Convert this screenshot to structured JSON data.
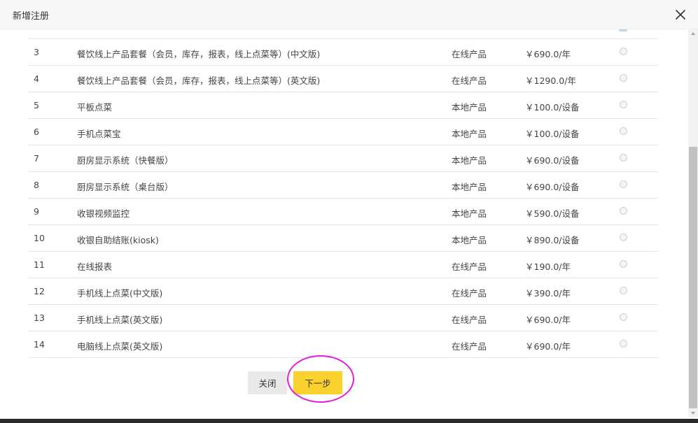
{
  "dialog": {
    "title": "新增注册",
    "close_icon": "close-icon"
  },
  "products": [
    {
      "num": "3",
      "name": "餐饮线上产品套餐（会员，库存，报表，线上点菜等）(中文版)",
      "type": "在线产品",
      "price": "￥690.0/年"
    },
    {
      "num": "4",
      "name": "餐饮线上产品套餐（会员，库存，报表，线上点菜等）(英文版)",
      "type": "在线产品",
      "price": "￥1290.0/年"
    },
    {
      "num": "5",
      "name": "平板点菜",
      "type": "本地产品",
      "price": "￥100.0/设备"
    },
    {
      "num": "6",
      "name": "手机点菜宝",
      "type": "本地产品",
      "price": "￥100.0/设备"
    },
    {
      "num": "7",
      "name": "厨房显示系统（快餐版）",
      "type": "本地产品",
      "price": "￥690.0/设备"
    },
    {
      "num": "8",
      "name": "厨房显示系统（桌台版）",
      "type": "本地产品",
      "price": "￥690.0/设备"
    },
    {
      "num": "9",
      "name": "收银视频监控",
      "type": "本地产品",
      "price": "￥590.0/设备"
    },
    {
      "num": "10",
      "name": "收银自助结账(kiosk)",
      "type": "本地产品",
      "price": "￥890.0/设备"
    },
    {
      "num": "11",
      "name": "在线报表",
      "type": "在线产品",
      "price": "￥190.0/年"
    },
    {
      "num": "12",
      "name": "手机线上点菜(中文版)",
      "type": "在线产品",
      "price": "￥390.0/年"
    },
    {
      "num": "13",
      "name": "手机线上点菜(英文版)",
      "type": "在线产品",
      "price": "￥690.0/年"
    },
    {
      "num": "14",
      "name": "电脑线上点菜(英文版)",
      "type": "在线产品",
      "price": "￥690.0/年"
    }
  ],
  "footer": {
    "close_label": "关闭",
    "next_label": "下一步"
  },
  "colors": {
    "accent_button": "#fbd12e",
    "highlight_ring": "#e41bdd"
  }
}
